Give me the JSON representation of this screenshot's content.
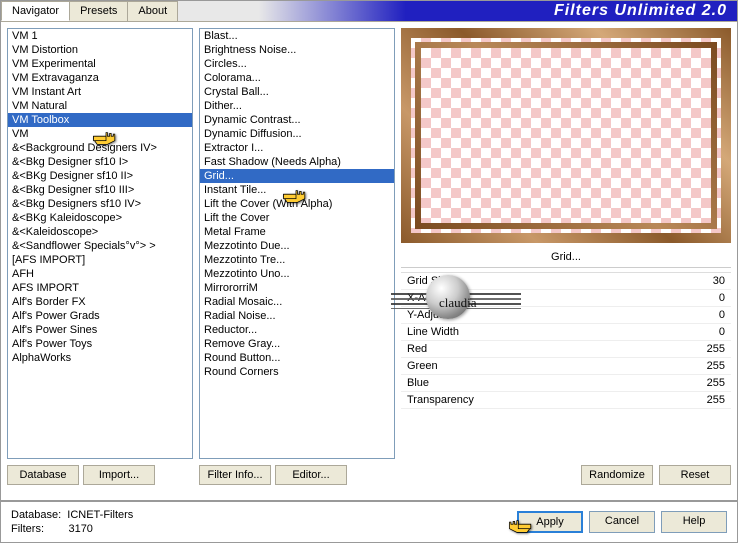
{
  "header": {
    "title": "Filters Unlimited 2.0"
  },
  "tabs": {
    "navigator": "Navigator",
    "presets": "Presets",
    "about": "About"
  },
  "categories": [
    "VM 1",
    "VM Distortion",
    "VM Experimental",
    "VM Extravaganza",
    "VM Instant Art",
    "VM Natural",
    "VM Toolbox",
    "VM",
    "&<Background Designers IV>",
    "&<Bkg Designer sf10 I>",
    "&<BKg Designer sf10 II>",
    "&<Bkg Designer sf10 III>",
    "&<Bkg Designers sf10 IV>",
    "&<BKg Kaleidoscope>",
    "&<Kaleidoscope>",
    "&<Sandflower Specials°v°> >",
    "[AFS IMPORT]",
    "AFH",
    "AFS IMPORT",
    "Alf's Border FX",
    "Alf's Power Grads",
    "Alf's Power Sines",
    "Alf's Power Toys",
    "AlphaWorks"
  ],
  "cat_sel": 6,
  "filters": [
    "Blast...",
    "Brightness Noise...",
    "Circles...",
    "Colorama...",
    "Crystal Ball...",
    "Dither...",
    "Dynamic Contrast...",
    "Dynamic Diffusion...",
    "Extractor I...",
    "Fast Shadow (Needs Alpha)",
    "Grid...",
    "Instant Tile...",
    "Lift the Cover (With Alpha)",
    "Lift the Cover",
    "Metal Frame",
    "Mezzotinto Due...",
    "Mezzotinto Tre...",
    "Mezzotinto Uno...",
    "MirrororriM",
    "Radial Mosaic...",
    "Radial Noise...",
    "Reductor...",
    "Remove Gray...",
    "Round Button...",
    "Round Corners"
  ],
  "filter_sel": 10,
  "buttons": {
    "database": "Database",
    "import": "Import...",
    "filterinfo": "Filter Info...",
    "editor": "Editor...",
    "randomize": "Randomize",
    "reset": "Reset",
    "apply": "Apply",
    "cancel": "Cancel",
    "help": "Help"
  },
  "preview": {
    "label": "Grid..."
  },
  "params": [
    {
      "name": "Grid Size",
      "value": "30"
    },
    {
      "name": "X-Adjust",
      "value": "0"
    },
    {
      "name": "Y-Adjust",
      "value": "0"
    },
    {
      "name": "Line Width",
      "value": "0"
    },
    {
      "name": "Red",
      "value": "255"
    },
    {
      "name": "Green",
      "value": "255"
    },
    {
      "name": "Blue",
      "value": "255"
    },
    {
      "name": "Transparency",
      "value": "255"
    }
  ],
  "footer": {
    "db_label": "Database:",
    "db_value": "ICNET-Filters",
    "filters_label": "Filters:",
    "filters_value": "3170"
  },
  "watermark": "claudia"
}
